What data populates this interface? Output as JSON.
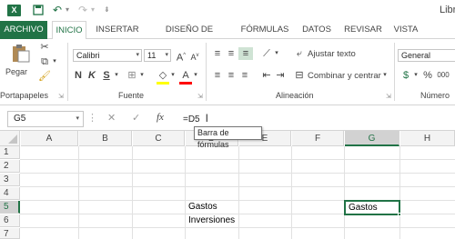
{
  "titlebar": {
    "app_title": "Libr"
  },
  "tabs": [
    "ARCHIVO",
    "INICIO",
    "INSERTAR",
    "DISEÑO DE PÁGINA",
    "FÓRMULAS",
    "DATOS",
    "REVISAR",
    "VISTA"
  ],
  "ribbon": {
    "paste_label": "Pegar",
    "font_name": "Calibri",
    "font_size": "11",
    "bold": "N",
    "italic": "K",
    "underline": "S",
    "wrap_text": "Ajustar texto",
    "merge_center": "Combinar y centrar",
    "number_format": "General",
    "percent": "%",
    "thousands": "000",
    "groups": {
      "clipboard": "Portapapeles",
      "font": "Fuente",
      "alignment": "Alineación",
      "number": "Número"
    }
  },
  "formula_bar": {
    "name_box": "G5",
    "fx": "fx",
    "formula": "=D5",
    "tooltip": "Barra de fórmulas"
  },
  "grid": {
    "columns": [
      "A",
      "B",
      "C",
      "D",
      "E",
      "F",
      "G",
      "H"
    ],
    "rows": [
      "1",
      "2",
      "3",
      "4",
      "5",
      "6",
      "7"
    ],
    "selected_column": "G",
    "selected_row": "5",
    "cells": {
      "D5": "Gastos",
      "D6": "Inversiones",
      "G5": "Gastos"
    }
  },
  "colors": {
    "accent": "#217346",
    "selection": "#d2d2d2"
  }
}
